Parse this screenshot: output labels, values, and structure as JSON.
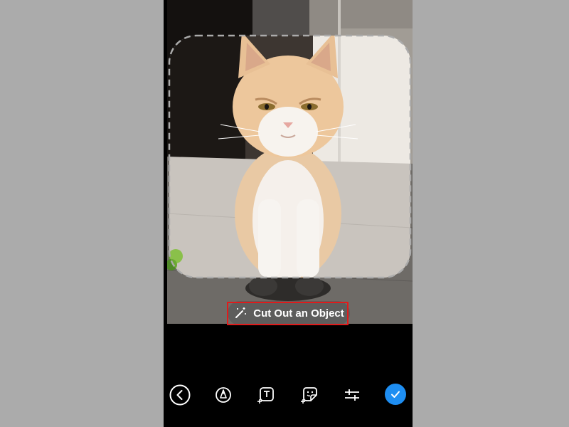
{
  "editor": {
    "action_label": "Cut Out an Object",
    "colors": {
      "accent": "#1e8ef2",
      "highlight": "#e01b1b",
      "pill": "#5a5a5a",
      "frame": "#ababab"
    }
  },
  "toolbar": {
    "items": [
      {
        "icon": "back-icon"
      },
      {
        "icon": "draw-pen-icon"
      },
      {
        "icon": "add-text-icon"
      },
      {
        "icon": "add-sticker-icon"
      },
      {
        "icon": "adjust-sliders-icon"
      },
      {
        "icon": "done-check-icon"
      }
    ]
  }
}
